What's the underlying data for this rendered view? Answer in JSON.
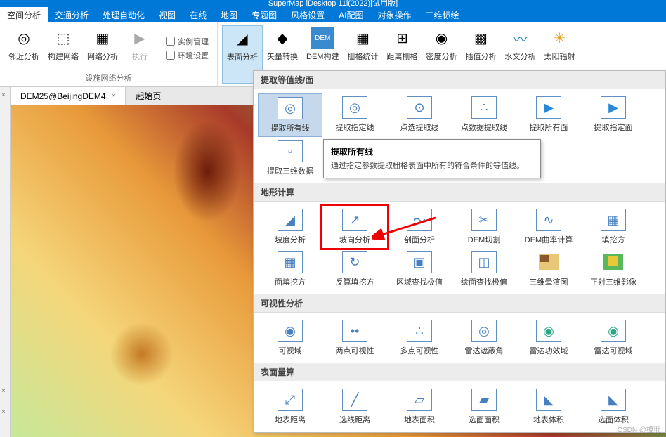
{
  "title": "SuperMap iDesktop 11i(2022)[试用版]",
  "menu": [
    "空间分析",
    "交通分析",
    "处理自动化",
    "视图",
    "在线",
    "地图",
    "专题图",
    "风格设置",
    "AI配图",
    "对象操作",
    "二维标绘"
  ],
  "active_menu": 0,
  "ribbon": {
    "group1": {
      "title": "设施网络分析",
      "items": [
        "邻近分析",
        "构建网络",
        "网络分析",
        "执行"
      ],
      "checks": [
        "实例管理",
        "环境设置"
      ]
    },
    "group2_items": [
      "表面分析",
      "矢量转换",
      "DEM构建",
      "栅格统计",
      "距离栅格",
      "密度分析",
      "插值分析",
      "水文分析",
      "太阳辐射"
    ],
    "active_ribbon": "表面分析"
  },
  "tabs": [
    {
      "label": "DEM25@BeijingDEM4",
      "active": true
    },
    {
      "label": "起始页",
      "active": false
    }
  ],
  "dropdown": {
    "sec1_title": "提取等值线/面",
    "sec1_items": [
      "提取所有线",
      "提取指定线",
      "点选提取线",
      "点数据提取线",
      "提取所有面",
      "提取指定面",
      "提取三维数据"
    ],
    "sec2_title": "地形计算",
    "sec2_items": [
      "坡度分析",
      "坡向分析",
      "剖面分析",
      "DEM切割",
      "DEM曲率计算",
      "填挖方",
      "面填挖方",
      "反算填挖方",
      "区域查找极值",
      "绘面查找极值",
      "三维晕渲图",
      "正射三维影像"
    ],
    "sec3_title": "可视性分析",
    "sec3_items": [
      "可视域",
      "两点可视性",
      "多点可视性",
      "雷达遮蔽角",
      "雷达功效域",
      "雷达可视域"
    ],
    "sec4_title": "表面量算",
    "sec4_items": [
      "地表距离",
      "选线距离",
      "地表面积",
      "选面面积",
      "地表体积",
      "选面体积"
    ]
  },
  "tooltip": {
    "title": "提取所有线",
    "body": "通过指定参数提取栅格表面中所有的符合条件的等值线。"
  },
  "watermark": "CSDN @橙玳"
}
